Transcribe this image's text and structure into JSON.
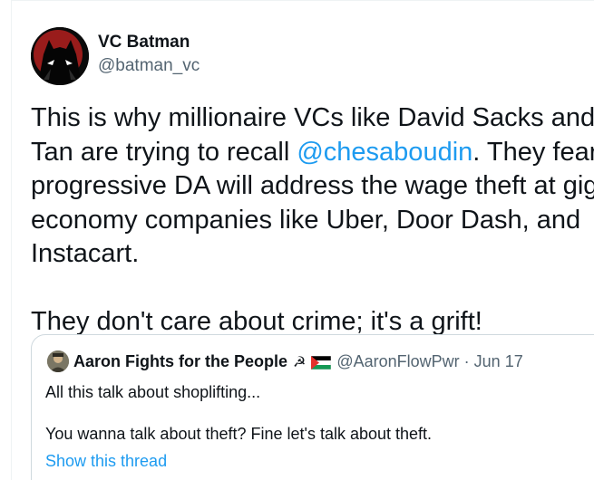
{
  "author": {
    "display_name": "VC Batman",
    "handle": "@batman_vc",
    "avatar_icon": "batman-avatar-icon"
  },
  "tweet": {
    "line1": "This is why millionaire VCs like David Sacks and G",
    "line2_before": "Tan are trying to recall ",
    "line2_mention": "@chesaboudin",
    "line2_after": ". They fear t",
    "line3": "progressive DA will address the wage theft at gig",
    "line4": "economy companies like Uber, Door Dash, and",
    "line5": "Instacart.",
    "line6": "They don't care about crime; it's a grift!"
  },
  "quoted_tweet": {
    "display_name": "Aaron Fights for the People",
    "name_emoji": "☭",
    "flag_icon": "palestine-flag-icon",
    "handle": "@AaronFlowPwr",
    "separator": "·",
    "date": "Jun 17",
    "line1": "All this talk about shoplifting...",
    "line2": "You wanna talk about theft? Fine let's talk about theft.",
    "show_thread": "Show this thread"
  },
  "colors": {
    "link_blue": "#1d9bf0",
    "secondary_gray": "#536471",
    "text_dark": "#0f1419",
    "border": "#cfd9de"
  }
}
